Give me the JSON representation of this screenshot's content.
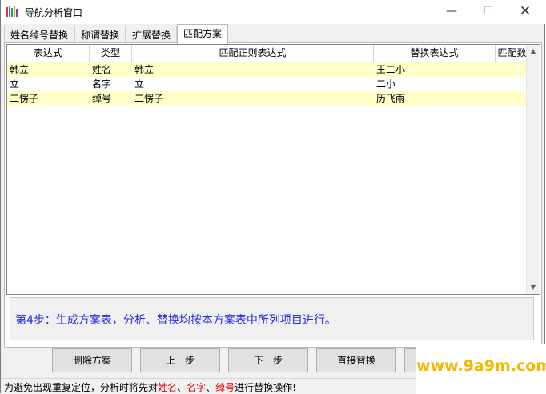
{
  "window": {
    "title": "导航分析窗口"
  },
  "tabs": [
    {
      "label": "姓名绰号替换"
    },
    {
      "label": "称谓替换"
    },
    {
      "label": "扩展替换"
    },
    {
      "label": "匹配方案"
    }
  ],
  "table": {
    "columns": [
      "表达式",
      "类型",
      "匹配正则表达式",
      "替换表达式",
      "匹配数"
    ],
    "rows": [
      {
        "expr": "韩立",
        "type": "姓名",
        "regex": "韩立",
        "replace": "王二小",
        "count": ""
      },
      {
        "expr": "立",
        "type": "名字",
        "regex": "立",
        "replace": "二小",
        "count": ""
      },
      {
        "expr": "二愣子",
        "type": "绰号",
        "regex": "二愣子",
        "replace": "历飞雨",
        "count": ""
      }
    ]
  },
  "info": {
    "text": "第4步：生成方案表，分析、替换均按本方案表中所列项目进行。"
  },
  "buttons": {
    "delete": "删除方案",
    "prev": "上一步",
    "next": "下一步",
    "replace": "直接替换"
  },
  "status": {
    "prefix": "为避免出现重复定位，分析时将先对",
    "name": "姓名",
    "sep1": "、",
    "given": "名字",
    "sep2": "、",
    "nick": "绰号",
    "suffix": "进行替换操作!"
  },
  "watermark": {
    "text": "www.9a9m.com"
  },
  "icons": {
    "app": "book-icon",
    "minimize": "minimize-icon",
    "maximize": "maximize-icon",
    "close": "close-icon"
  },
  "colors": {
    "row_highlight": "#ffffc8",
    "info_text": "#2a2ae0",
    "status_highlight": "#e00000",
    "watermark": "#f4b800"
  }
}
